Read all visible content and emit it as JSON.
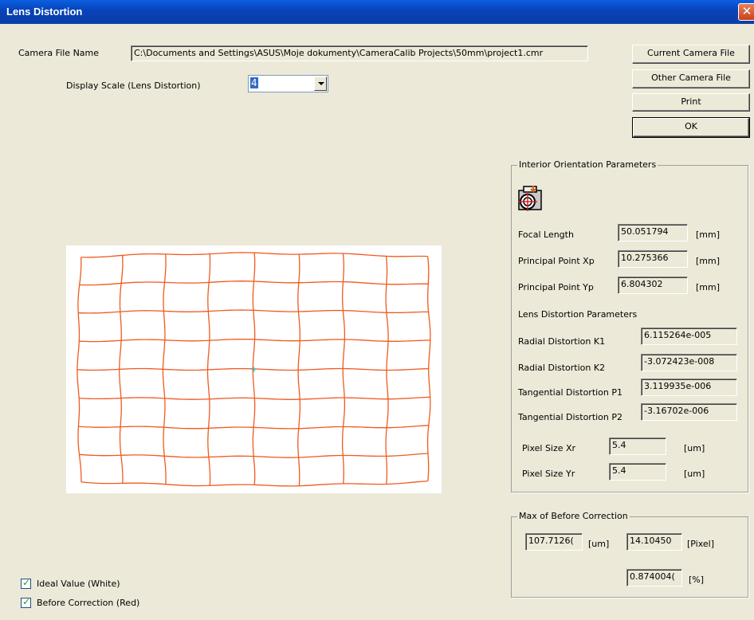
{
  "window": {
    "title": "Lens Distortion",
    "close_glyph": "✕"
  },
  "camera_file": {
    "label": "Camera File Name",
    "value": "C:\\Documents and Settings\\ASUS\\Moje dokumenty\\CameraCalib Projects\\50mm\\project1.cmr"
  },
  "display_scale": {
    "label": "Display Scale (Lens Distortion)",
    "value": "4"
  },
  "buttons": {
    "current": "Current Camera File",
    "other": "Other Camera File",
    "print": "Print",
    "ok": "OK"
  },
  "interior": {
    "title": "Interior Orientation Parameters",
    "icon": "camera-target-icon",
    "focal_length": {
      "label": "Focal Length",
      "value": "50.051794",
      "unit": "[mm]"
    },
    "xp": {
      "label": "Principal Point Xp",
      "value": "10.275366",
      "unit": "[mm]"
    },
    "yp": {
      "label": "Principal Point Yp",
      "value": "6.804302",
      "unit": "[mm]"
    },
    "lens_heading": "Lens Distortion Parameters",
    "k1": {
      "label": "Radial Distortion K1",
      "value": "6.115264e-005"
    },
    "k2": {
      "label": "Radial Distortion K2",
      "value": "-3.072423e-008"
    },
    "p1": {
      "label": "Tangential Distortion P1",
      "value": "3.119935e-006"
    },
    "p2": {
      "label": "Tangential Distortion P2",
      "value": "-3.16702e-006"
    },
    "xr": {
      "label": "Pixel Size Xr",
      "value": "5.4",
      "unit": "[um]"
    },
    "yr": {
      "label": "Pixel Size Yr",
      "value": "5.4",
      "unit": "[um]"
    }
  },
  "max_before": {
    "title": "Max of Before Correction",
    "um_value": "107.7126(",
    "um_unit": "[um]",
    "px_value": "14.10450",
    "px_unit": "[Pixel]",
    "pct_value": "0.874004(",
    "pct_unit": "[%]"
  },
  "checkboxes": {
    "ideal": "Ideal Value (White)",
    "before": "Before Correction (Red)"
  },
  "plot": {
    "grid_cols": 8,
    "grid_rows": 8,
    "ideal_color": "#ffffff",
    "distorted_color": "#f05a1e",
    "center_marker_color": "#40c0c0"
  }
}
